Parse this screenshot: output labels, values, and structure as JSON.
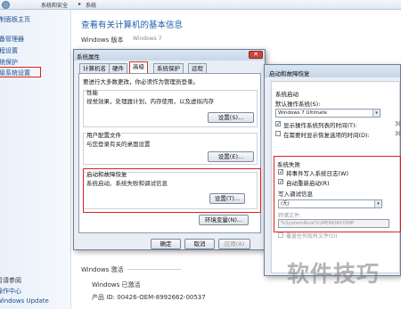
{
  "topbar": {
    "crumbs": [
      "系统和安全",
      "系统"
    ]
  },
  "leftpane": {
    "items": [
      "控制面板主页",
      "设备管理器",
      "远程设置",
      "系统保护",
      "高级系统设置"
    ],
    "bottom_items": [
      "另请参阅",
      "操作中心",
      "Windows Update"
    ]
  },
  "main": {
    "title": "查看有关计算机的基本信息",
    "edition_label": "Windows 版本",
    "edition_value": "Windows 7",
    "activation_heading": "Windows 激活",
    "activation_status": "Windows 已激活",
    "product_id": "产品 ID: 00426-OEM-8992662-00537"
  },
  "sysprops": {
    "title": "系统属性",
    "tabs": [
      "计算机名",
      "硬件",
      "高级",
      "系统保护",
      "远程"
    ],
    "active_tab": "高级",
    "admin_note": "要进行大多数更改，你必须作为管理员登录。",
    "performance": {
      "title": "性能",
      "desc": "视觉效果，处理器计划，内存使用，以及虚拟内存",
      "button": "设置(S)..."
    },
    "profiles": {
      "title": "用户配置文件",
      "desc": "与您登录有关的桌面设置",
      "button": "设置(E)..."
    },
    "startup": {
      "title": "启动和故障恢复",
      "desc": "系统启动、系统失败和调试信息",
      "button": "设置(T)..."
    },
    "env_button": "环境变量(N)...",
    "ok": "确定",
    "cancel": "取消",
    "apply": "应用(A)"
  },
  "startrec": {
    "title": "启动和故障恢复",
    "system_startup": "系统启动",
    "default_os_label": "默认操作系统(S):",
    "default_os_value": "Windows 7 Ultimate",
    "show_os_list": "显示操作系统列表的时间(T):",
    "show_recovery": "在需要时显示恢复选项的时间(D):",
    "system_failure": "系统失败",
    "write_event": "将事件写入系统日志(W)",
    "auto_restart": "自动重新启动(R)",
    "write_debug": "写入调试信息",
    "debug_value": "(无)",
    "dump_file_label": "转储文件:",
    "dump_file_value": "%SystemRoot%\\MEMORY.DMP",
    "overwrite": "覆盖任何现有文件(O)"
  },
  "watermark": "软件技巧"
}
